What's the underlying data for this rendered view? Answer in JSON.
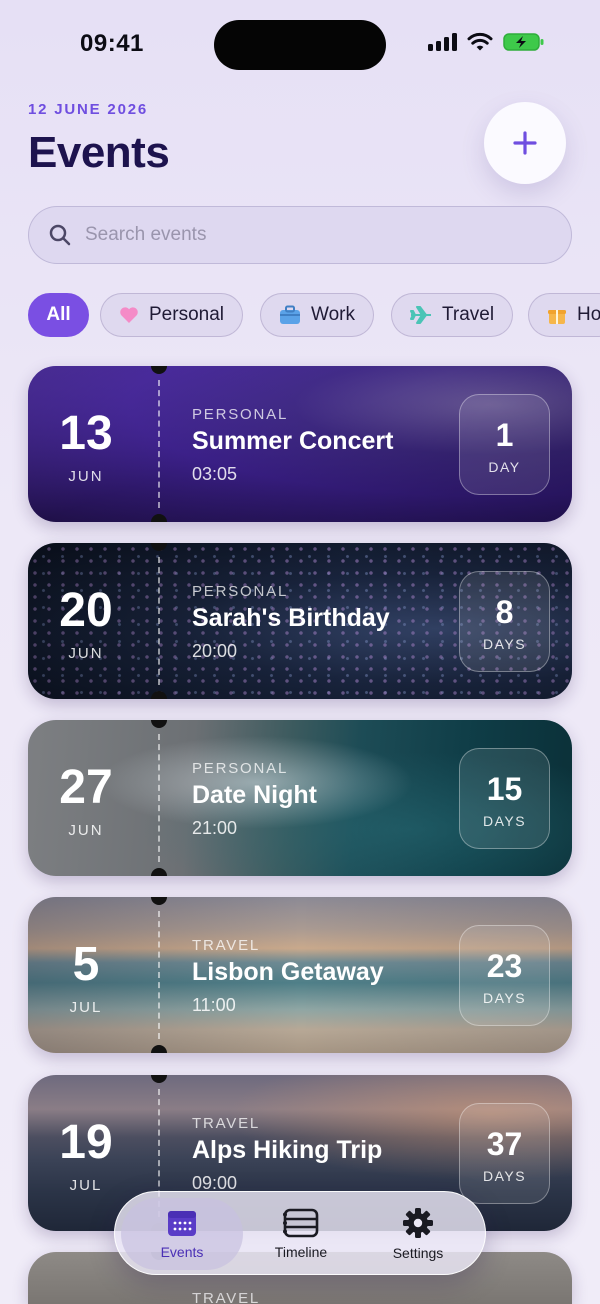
{
  "status_bar": {
    "time": "09:41"
  },
  "header": {
    "date": "12 JUNE 2026",
    "title": "Events"
  },
  "search": {
    "placeholder": "Search events"
  },
  "filters": [
    {
      "label": "All",
      "icon": "",
      "active": true
    },
    {
      "label": "Personal",
      "icon": "heart-icon",
      "active": false
    },
    {
      "label": "Work",
      "icon": "briefcase-icon",
      "active": false
    },
    {
      "label": "Travel",
      "icon": "airplane-icon",
      "active": false
    },
    {
      "label": "Ho",
      "icon": "gift-icon",
      "active": false
    }
  ],
  "events": [
    {
      "day": "13",
      "month": "JUN",
      "category": "PERSONAL",
      "title": "Summer Concert",
      "time": "03:05",
      "count": "1",
      "unit": "DAY",
      "theme": "concert"
    },
    {
      "day": "20",
      "month": "JUN",
      "category": "PERSONAL",
      "title": "Sarah's Birthday",
      "time": "20:00",
      "count": "8",
      "unit": "DAYS",
      "theme": "confetti"
    },
    {
      "day": "27",
      "month": "JUN",
      "category": "PERSONAL",
      "title": "Date Night",
      "time": "21:00",
      "count": "15",
      "unit": "DAYS",
      "theme": "ocean"
    },
    {
      "day": "5",
      "month": "JUL",
      "category": "TRAVEL",
      "title": "Lisbon Getaway",
      "time": "11:00",
      "count": "23",
      "unit": "DAYS",
      "theme": "beach"
    },
    {
      "day": "19",
      "month": "JUL",
      "category": "TRAVEL",
      "title": "Alps Hiking Trip",
      "time": "09:00",
      "count": "37",
      "unit": "DAYS",
      "theme": "mountains"
    },
    {
      "day": "",
      "month": "",
      "category": "TRAVEL",
      "title": "",
      "time": "",
      "count": "",
      "unit": "",
      "theme": "map"
    }
  ],
  "tab_bar": [
    {
      "label": "Events",
      "icon": "calendar-icon",
      "active": true
    },
    {
      "label": "Timeline",
      "icon": "timeline-icon",
      "active": false
    },
    {
      "label": "Settings",
      "icon": "gear-icon",
      "active": false
    }
  ],
  "colors": {
    "accent": "#7a4fe3",
    "title": "#1d134e",
    "background": "#ece7f7"
  }
}
